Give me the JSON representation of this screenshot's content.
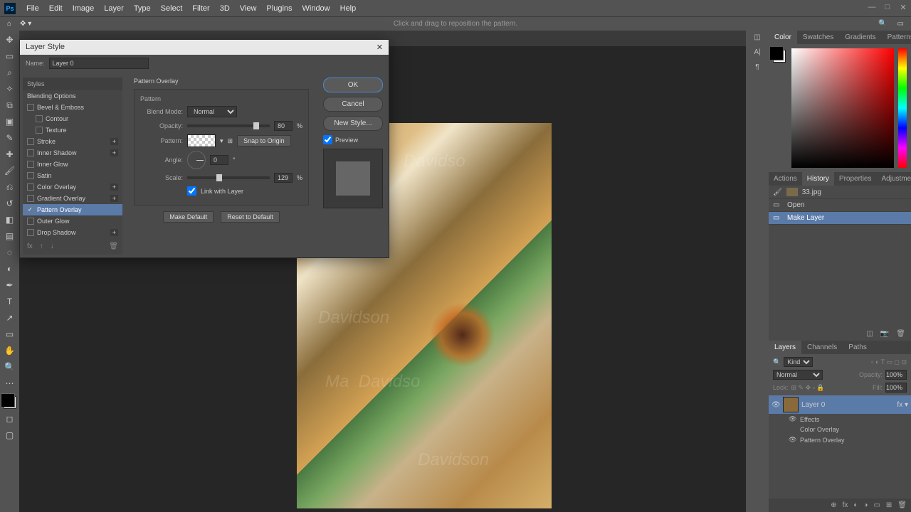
{
  "app": {
    "logo": "Ps",
    "hint": "Click and drag to reposition the pattern."
  },
  "menu": [
    "File",
    "Edit",
    "Image",
    "Layer",
    "Type",
    "Select",
    "Filter",
    "3D",
    "View",
    "Plugins",
    "Window",
    "Help"
  ],
  "panels": {
    "color_tabs": [
      "Color",
      "Swatches",
      "Gradients",
      "Patterns"
    ],
    "hist_tabs": [
      "Actions",
      "History",
      "Properties",
      "Adjustments"
    ],
    "hist_doc": "33.jpg",
    "history": [
      "Open",
      "Make Layer"
    ],
    "layer_tabs": [
      "Layers",
      "Channels",
      "Paths"
    ],
    "layer_opts": {
      "kind": "Kind",
      "blend": "Normal",
      "opacity_label": "Opacity:",
      "opacity": "100%",
      "lock": "Lock:",
      "fill_label": "Fill:",
      "fill": "100%"
    },
    "layer0": "Layer 0",
    "effects": "Effects",
    "fx1": "Color Overlay",
    "fx2": "Pattern Overlay"
  },
  "dialog": {
    "title": "Layer Style",
    "name_label": "Name:",
    "name_value": "Layer 0",
    "styles_header": "Styles",
    "blending_options": "Blending Options",
    "effects": [
      {
        "label": "Bevel & Emboss",
        "checked": false,
        "plus": false
      },
      {
        "label": "Contour",
        "checked": false,
        "plus": false,
        "indent": true
      },
      {
        "label": "Texture",
        "checked": false,
        "plus": false,
        "indent": true
      },
      {
        "label": "Stroke",
        "checked": false,
        "plus": true
      },
      {
        "label": "Inner Shadow",
        "checked": false,
        "plus": true
      },
      {
        "label": "Inner Glow",
        "checked": false,
        "plus": false
      },
      {
        "label": "Satin",
        "checked": false,
        "plus": false
      },
      {
        "label": "Color Overlay",
        "checked": false,
        "plus": true
      },
      {
        "label": "Gradient Overlay",
        "checked": false,
        "plus": true
      },
      {
        "label": "Pattern Overlay",
        "checked": true,
        "plus": false,
        "active": true
      },
      {
        "label": "Outer Glow",
        "checked": false,
        "plus": false
      },
      {
        "label": "Drop Shadow",
        "checked": false,
        "plus": true
      }
    ],
    "section": "Pattern Overlay",
    "sub": "Pattern",
    "blend_mode_label": "Blend Mode:",
    "blend_mode": "Normal",
    "opacity_label": "Opacity:",
    "opacity": "80",
    "pct": "%",
    "pattern_label": "Pattern:",
    "snap": "Snap to Origin",
    "angle_label": "Angle:",
    "angle": "0",
    "deg": "°",
    "scale_label": "Scale:",
    "scale": "129",
    "link": "Link with Layer",
    "make_default": "Make Default",
    "reset_default": "Reset to Default",
    "ok": "OK",
    "cancel": "Cancel",
    "new_style": "New Style...",
    "preview": "Preview"
  }
}
